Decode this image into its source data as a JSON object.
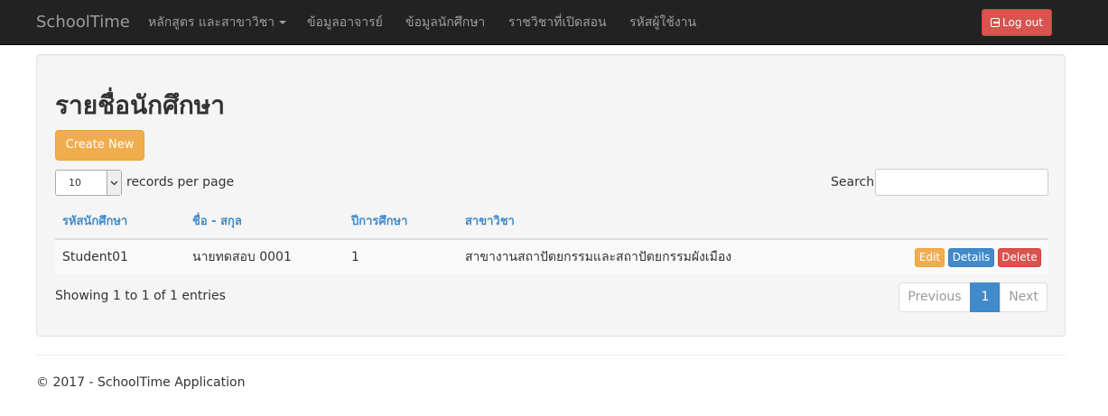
{
  "navbar": {
    "brand": "SchoolTime",
    "items": [
      {
        "label": "หลักสูตร และสาขาวิชา",
        "dropdown": true
      },
      {
        "label": "ข้อมูลอาจารย์"
      },
      {
        "label": "ข้อมูลนักศึกษา"
      },
      {
        "label": "ราชวิชาที่เปิดสอน"
      },
      {
        "label": "รหัสผู้ใช้งาน"
      }
    ],
    "logout_label": "Log out",
    "logout_icon": "logout-icon"
  },
  "main": {
    "title": "รายชื่อนักศึกษา",
    "create_label": "Create New",
    "length": {
      "selected": "10",
      "label": "records per page"
    },
    "search": {
      "label": "Search:",
      "value": ""
    },
    "table": {
      "headers": [
        "รหัสนักศึกษา",
        "ชื่อ - สกุล",
        "ปีการศึกษา",
        "สาขาวิชา"
      ],
      "rows": [
        {
          "cells": [
            "Student01",
            "นายทดสอบ 0001",
            "1",
            "สาขางานสถาปัตยกรรมและสถาปัตยกรรมผังเมือง"
          ],
          "actions": {
            "edit": "Edit",
            "details": "Details",
            "delete": "Delete"
          }
        }
      ]
    },
    "info": "Showing 1 to 1 of 1 entries",
    "pagination": {
      "previous": "Previous",
      "current": "1",
      "next": "Next"
    }
  },
  "footer": {
    "text": "© 2017 - SchoolTime Application"
  },
  "colors": {
    "navbar": "#222222",
    "link": "#428bca",
    "warning": "#f0ad4e",
    "danger": "#d9534f",
    "primary": "#428bca"
  }
}
